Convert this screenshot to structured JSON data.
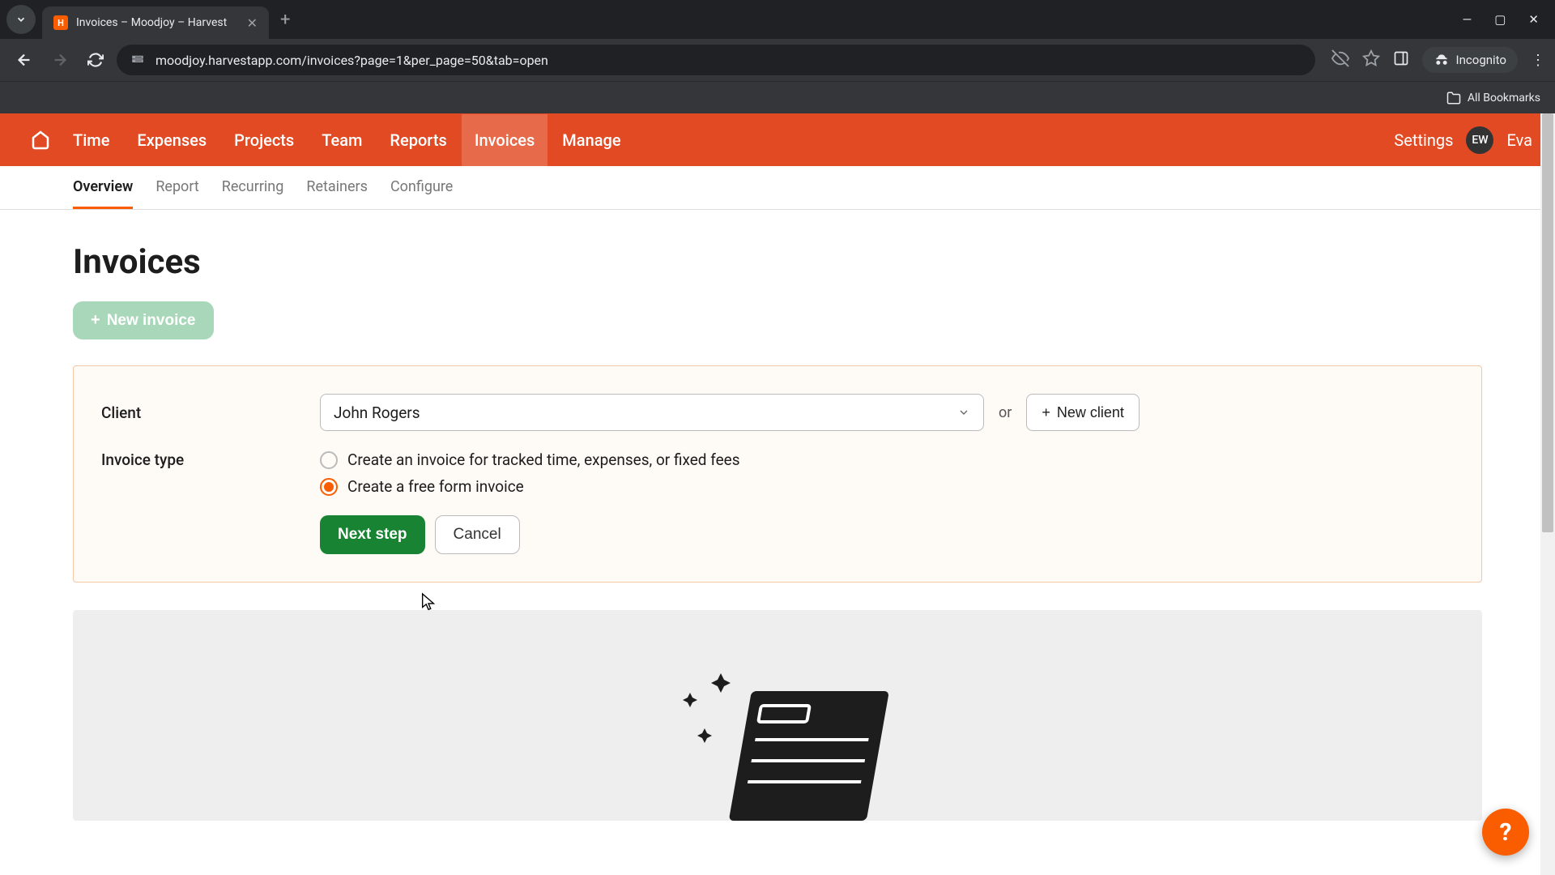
{
  "browser": {
    "tab_title": "Invoices – Moodjoy – Harvest",
    "tab_favicon_letter": "H",
    "url": "moodjoy.harvestapp.com/invoices?page=1&per_page=50&tab=open",
    "incognito_label": "Incognito",
    "all_bookmarks": "All Bookmarks"
  },
  "header": {
    "nav": [
      "Time",
      "Expenses",
      "Projects",
      "Team",
      "Reports",
      "Invoices",
      "Manage"
    ],
    "active_nav": "Invoices",
    "settings": "Settings",
    "avatar_initials": "EW",
    "user_name": "Eva"
  },
  "subnav": {
    "items": [
      "Overview",
      "Report",
      "Recurring",
      "Retainers",
      "Configure"
    ],
    "active": "Overview"
  },
  "page": {
    "title": "Invoices",
    "new_invoice_label": "New invoice"
  },
  "form": {
    "client_label": "Client",
    "client_value": "John Rogers",
    "or_text": "or",
    "new_client_label": "New client",
    "invoice_type_label": "Invoice type",
    "option_tracked": "Create an invoice for tracked time, expenses, or fixed fees",
    "option_freeform": "Create a free form invoice",
    "selected_option": "freeform",
    "next_step": "Next step",
    "cancel": "Cancel"
  },
  "help_fab": "?"
}
